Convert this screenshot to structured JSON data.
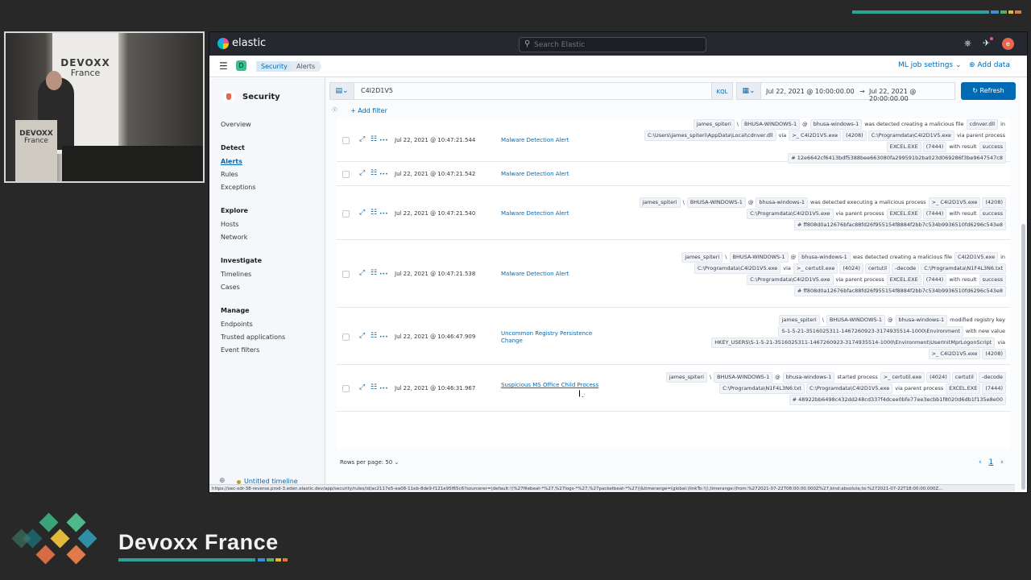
{
  "conference": {
    "logo_text": "Devoxx France",
    "camera_banner_title": "DEVOXX",
    "camera_banner_sub": "France",
    "camera_podium_title": "DEVOXX",
    "camera_podium_sub": "France"
  },
  "header": {
    "brand": "elastic",
    "search_placeholder": "Search Elastic",
    "avatar_initial": "e"
  },
  "subheader": {
    "space_initial": "D",
    "breadcrumbs": [
      "Security",
      "Alerts"
    ],
    "ml_settings": "ML job settings",
    "add_data": "Add data"
  },
  "sidebar": {
    "title": "Security",
    "overview": "Overview",
    "detect_head": "Detect",
    "alerts": "Alerts",
    "rules": "Rules",
    "exceptions": "Exceptions",
    "explore_head": "Explore",
    "hosts": "Hosts",
    "network": "Network",
    "investigate_head": "Investigate",
    "timelines": "Timelines",
    "cases": "Cases",
    "manage_head": "Manage",
    "endpoints": "Endpoints",
    "trusted_apps": "Trusted applications",
    "event_filters": "Event filters"
  },
  "query": {
    "text": "C4I2D1V5",
    "language": "KQL",
    "date_start": "Jul 22, 2021 @ 10:00:00.00",
    "date_arrow": "→",
    "date_end": "Jul 22, 2021 @ 20:00:00.00",
    "refresh": "Refresh",
    "add_filter": "+ Add filter"
  },
  "alerts": [
    {
      "timestamp": "Jul 22, 2021 @ 10:47:21.544",
      "rule": "Malware Detection Alert",
      "reason": [
        [
          {
            "t": "tok",
            "v": "james_spiteri"
          },
          {
            "t": "txt",
            "v": "\\"
          },
          {
            "t": "tok",
            "v": "BHUSA-WINDOWS-1"
          },
          {
            "t": "txt",
            "v": "@"
          },
          {
            "t": "tok",
            "v": "bhusa-windows-1"
          },
          {
            "t": "txt",
            "v": "was detected creating a malicious file"
          },
          {
            "t": "tok",
            "v": "cdnver.dll"
          },
          {
            "t": "txt",
            "v": "in"
          }
        ],
        [
          {
            "t": "tok",
            "v": "C:\\Users\\james_spiteri\\AppData\\Local\\cdnver.dll"
          },
          {
            "t": "txt",
            "v": "via"
          },
          {
            "t": "tok",
            "v": ">_ C4I2D1V5.exe"
          },
          {
            "t": "tok",
            "v": "(4208)"
          },
          {
            "t": "tok",
            "v": "C:\\Programdata\\C4I2D1V5.exe"
          },
          {
            "t": "txt",
            "v": "via parent process"
          }
        ],
        [
          {
            "t": "tok",
            "v": "EXCEL.EXE"
          },
          {
            "t": "tok",
            "v": "(7444)"
          },
          {
            "t": "txt",
            "v": "with result"
          },
          {
            "t": "tok",
            "v": "success"
          }
        ],
        [
          {
            "t": "tok",
            "v": "# 12e6642cf6413bdf5388bee663080fa299591b2ba023d069286f3be9647547c8"
          }
        ]
      ]
    },
    {
      "timestamp": "Jul 22, 2021 @ 10:47:21.542",
      "rule": "Malware Detection Alert",
      "reason": []
    },
    {
      "timestamp": "Jul 22, 2021 @ 10:47:21.540",
      "rule": "Malware Detection Alert",
      "reason": [
        [
          {
            "t": "tok",
            "v": "james_spiteri"
          },
          {
            "t": "txt",
            "v": "\\"
          },
          {
            "t": "tok",
            "v": "BHUSA-WINDOWS-1"
          },
          {
            "t": "txt",
            "v": "@"
          },
          {
            "t": "tok",
            "v": "bhusa-windows-1"
          },
          {
            "t": "txt",
            "v": "was detected executing a malicious process"
          },
          {
            "t": "tok",
            "v": ">_ C4I2D1V5.exe"
          },
          {
            "t": "tok",
            "v": "(4208)"
          }
        ],
        [
          {
            "t": "tok",
            "v": "C:\\Programdata\\C4I2D1V5.exe"
          },
          {
            "t": "txt",
            "v": "via parent process"
          },
          {
            "t": "tok",
            "v": "EXCEL.EXE"
          },
          {
            "t": "tok",
            "v": "(7444)"
          },
          {
            "t": "txt",
            "v": "with result"
          },
          {
            "t": "tok",
            "v": "success"
          }
        ],
        [
          {
            "t": "tok",
            "v": "# ff808d0a12676bfac88fd26f955154f8884f2bb7c534b9936510fd6296c543e8"
          }
        ]
      ]
    },
    {
      "timestamp": "Jul 22, 2021 @ 10:47:21.538",
      "rule": "Malware Detection Alert",
      "reason": [
        [
          {
            "t": "tok",
            "v": "james_spiteri"
          },
          {
            "t": "txt",
            "v": "\\"
          },
          {
            "t": "tok",
            "v": "BHUSA-WINDOWS-1"
          },
          {
            "t": "txt",
            "v": "@"
          },
          {
            "t": "tok",
            "v": "bhusa-windows-1"
          },
          {
            "t": "txt",
            "v": "was detected creating a malicious file"
          },
          {
            "t": "tok",
            "v": "C4I2D1V5.exe"
          },
          {
            "t": "txt",
            "v": "in"
          }
        ],
        [
          {
            "t": "tok",
            "v": "C:\\Programdata\\C4I2D1V5.exe"
          },
          {
            "t": "txt",
            "v": "via"
          },
          {
            "t": "tok",
            "v": ">_ certutil.exe"
          },
          {
            "t": "tok",
            "v": "(4024)"
          },
          {
            "t": "tok",
            "v": "certutil"
          },
          {
            "t": "tok",
            "v": "-decode"
          },
          {
            "t": "tok",
            "v": "C:\\Programdata\\N1F4L3N6.txt"
          }
        ],
        [
          {
            "t": "tok",
            "v": "C:\\Programdata\\C4I2D1V5.exe"
          },
          {
            "t": "txt",
            "v": "via parent process"
          },
          {
            "t": "tok",
            "v": "EXCEL.EXE"
          },
          {
            "t": "tok",
            "v": "(7444)"
          },
          {
            "t": "txt",
            "v": "with result"
          },
          {
            "t": "tok",
            "v": "success"
          }
        ],
        [
          {
            "t": "tok",
            "v": "# ff808d0a12676bfac88fd26f955154f8884f2bb7c534b9936510fd6296c543e8"
          }
        ]
      ]
    },
    {
      "timestamp": "Jul 22, 2021 @ 10:46:47.909",
      "rule": "Uncommon Registry Persistence Change",
      "reason": [
        [
          {
            "t": "tok",
            "v": "james_spiteri"
          },
          {
            "t": "txt",
            "v": "\\"
          },
          {
            "t": "tok",
            "v": "BHUSA-WINDOWS-1"
          },
          {
            "t": "txt",
            "v": "@"
          },
          {
            "t": "tok",
            "v": "bhusa-windows-1"
          },
          {
            "t": "txt",
            "v": "modified registry key"
          }
        ],
        [
          {
            "t": "tok",
            "v": "S-1-5-21-3516025311-1467260923-3174935514-1000\\Environment"
          },
          {
            "t": "txt",
            "v": "with new value"
          }
        ],
        [
          {
            "t": "tok",
            "v": "HKEY_USERS\\S-1-5-21-3516025311-1467260923-3174935514-1000\\Environment\\UserInitMprLogonScript"
          },
          {
            "t": "txt",
            "v": "via"
          }
        ],
        [
          {
            "t": "tok",
            "v": ">_ C4I2D1V5.exe"
          },
          {
            "t": "tok",
            "v": "(4208)"
          }
        ]
      ]
    },
    {
      "timestamp": "Jul 22, 2021 @ 10:46:31.967",
      "rule": "Suspicious MS Office Child Process",
      "reason": [
        [
          {
            "t": "tok",
            "v": "james_spiteri"
          },
          {
            "t": "txt",
            "v": "\\"
          },
          {
            "t": "tok",
            "v": "BHUSA-WINDOWS-1"
          },
          {
            "t": "txt",
            "v": "@"
          },
          {
            "t": "tok",
            "v": "bhusa-windows-1"
          },
          {
            "t": "txt",
            "v": "started process"
          },
          {
            "t": "tok",
            "v": ">_ certutil.exe"
          },
          {
            "t": "tok",
            "v": "(4024)"
          },
          {
            "t": "tok",
            "v": "certutil"
          },
          {
            "t": "tok",
            "v": "-decode"
          }
        ],
        [
          {
            "t": "tok",
            "v": "C:\\Programdata\\N1F4L3N6.txt"
          },
          {
            "t": "tok",
            "v": "C:\\Programdata\\C4I2D1V5.exe"
          },
          {
            "t": "txt",
            "v": "via parent process"
          },
          {
            "t": "tok",
            "v": "EXCEL.EXE"
          },
          {
            "t": "tok",
            "v": "(7444)"
          }
        ],
        [
          {
            "t": "tok",
            "v": "# 48922bb6498c432dd248cd337f4dcee0bfe77ee3ecbb1f8020d6db1f135e8e00"
          }
        ]
      ]
    }
  ],
  "pager": {
    "rows_per_page": "Rows per page: 50",
    "page": "1"
  },
  "timeline": {
    "label": "Untitled timeline"
  },
  "status_url": "https://sec-xdr-38-reverse.prod-3.eden.elastic.dev/app/security/rules/id/ac2117e5-ea08-11eb-8de9-f121e95f65c6?sourcerer=(default:!(%27filebeat-*%27,%27logs-*%27,%27packetbeat-*%27))&timerange=(global:(linkTo:!(),timerange:(from:%272021-07-22T08:00:00.000Z%27,kind:absolute,to:%272021-07-22T18:00:00.000Z..."
}
